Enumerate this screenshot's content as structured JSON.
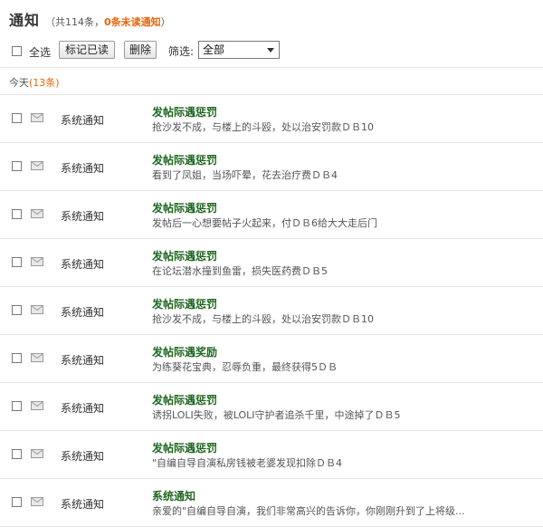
{
  "header": {
    "title": "通知",
    "summary_prefix": "（共114条，",
    "summary_unread": "0条未读通知",
    "summary_suffix": "）"
  },
  "toolbar": {
    "select_all_label": "全选",
    "mark_read_label": "标记已读",
    "delete_label": "删除",
    "filter_label": "筛选:",
    "filter_value": "全部"
  },
  "section": {
    "label": "今天",
    "count": "(13条)"
  },
  "items": [
    {
      "type": "系统通知",
      "subject": "发帖际遇惩罚",
      "body": "抢沙发不成，与楼上的斗殴，处以治安罚款ＤＢ10"
    },
    {
      "type": "系统通知",
      "subject": "发帖际遇惩罚",
      "body": "看到了凤姐，当场吓晕，花去治疗费ＤＢ4"
    },
    {
      "type": "系统通知",
      "subject": "发帖际遇惩罚",
      "body": "发帖后一心想要帖子火起来，付ＤＢ6给大大走后门"
    },
    {
      "type": "系统通知",
      "subject": "发帖际遇惩罚",
      "body": "在论坛潜水撞到鱼雷，损失医药费ＤＢ5"
    },
    {
      "type": "系统通知",
      "subject": "发帖际遇惩罚",
      "body": "抢沙发不成，与楼上的斗殴，处以治安罚款ＤＢ10"
    },
    {
      "type": "系统通知",
      "subject": "发帖际遇奖励",
      "body": "为练葵花宝典，忍辱负重，最终获得5ＤＢ"
    },
    {
      "type": "系统通知",
      "subject": "发帖际遇惩罚",
      "body": "诱拐LOLI失败，被LOLI守护者追杀千里，中途掉了ＤＢ5"
    },
    {
      "type": "系统通知",
      "subject": "发帖际遇惩罚",
      "body": "\"自编自导自演私房钱被老婆发现扣除ＤＢ4"
    },
    {
      "type": "系统通知",
      "subject": "系统通知",
      "body": "亲爱的\"自编自导自演，我们非常高兴的告诉你，你刚刚升到了上将级..."
    }
  ]
}
